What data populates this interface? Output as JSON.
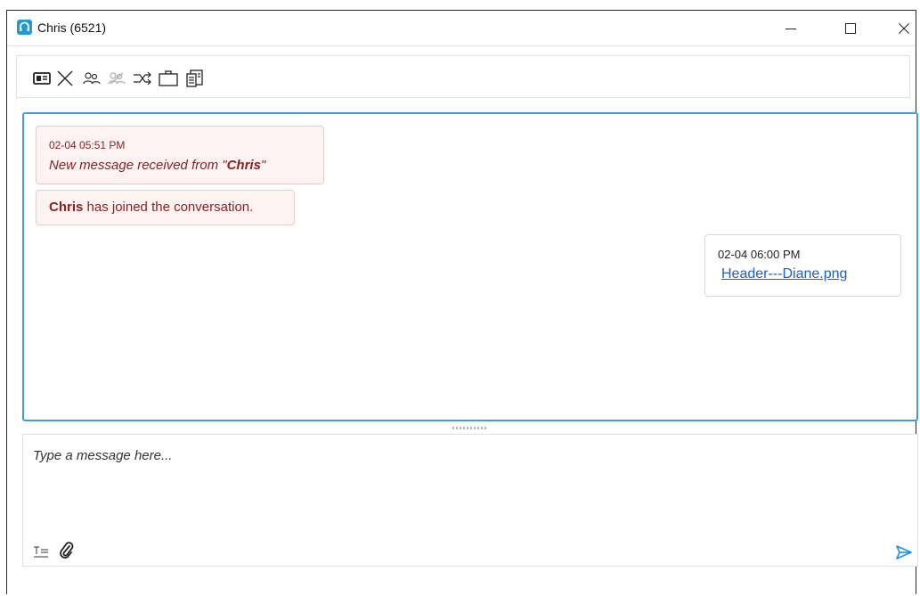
{
  "window": {
    "title": "Chris (6521)",
    "icon": "headset-icon",
    "controls": [
      "minimize-icon",
      "maximize-icon",
      "close-icon"
    ]
  },
  "toolbar": {
    "icons": [
      "contact-card-icon",
      "end-chat-icon",
      "conference-icon",
      "remove-participant-icon",
      "transfer-icon",
      "briefcase-icon",
      "transcript-icon"
    ]
  },
  "conversation": {
    "messages": [
      {
        "type": "system",
        "timestamp": "02-04 05:51 PM",
        "text_prefix": "New message received from \"",
        "text_name": "Chris",
        "text_suffix": "\""
      },
      {
        "type": "system",
        "name": "Chris",
        "text": " has joined the conversation."
      },
      {
        "type": "outgoing",
        "timestamp": "02-04 06:00 PM",
        "attachment": "Header---Diane.png"
      }
    ]
  },
  "compose": {
    "placeholder": "Type a message here...",
    "value": "",
    "icons": [
      "text-format-icon",
      "attach-icon",
      "send-icon"
    ]
  },
  "colors": {
    "accent": "#3aa0e6",
    "system_text": "#8b1e1e",
    "system_bg": "#fdf3f3",
    "link": "#1a5fcf"
  }
}
